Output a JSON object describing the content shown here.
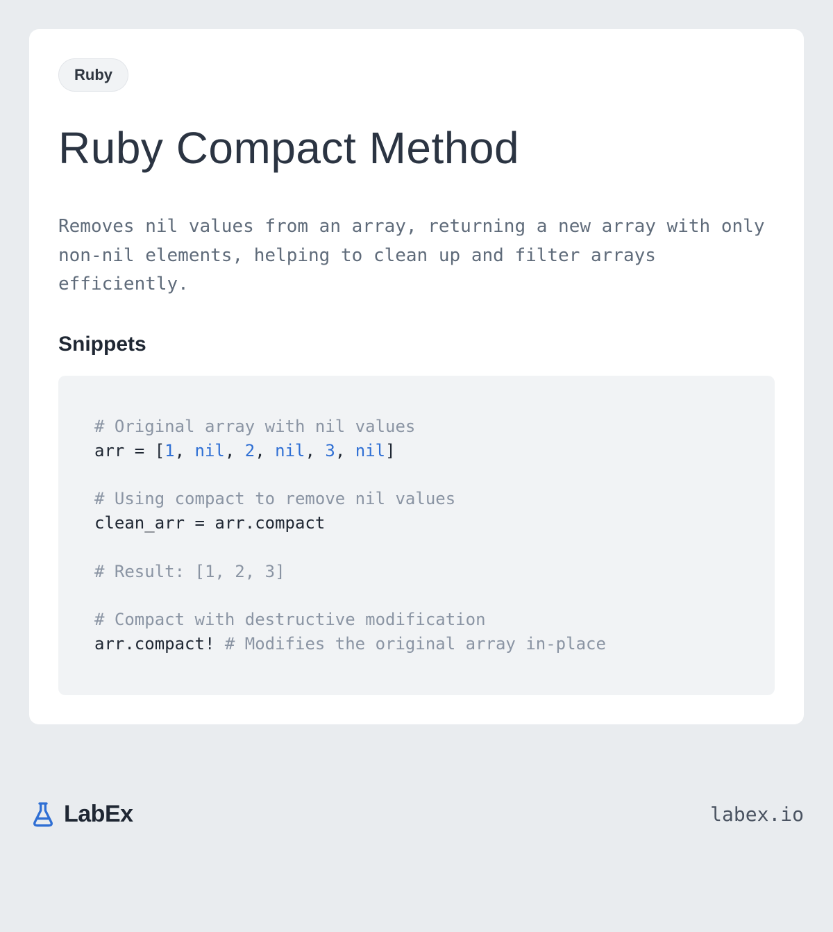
{
  "tag": "Ruby",
  "title": "Ruby Compact Method",
  "description": "Removes nil values from an array, returning a new array with only non-nil elements, helping to clean up and filter arrays efficiently.",
  "snippets_heading": "Snippets",
  "code": {
    "c1": "# Original array with nil values",
    "l1_a": "arr = [",
    "l1_n1": "1",
    "l1_s1": ", ",
    "l1_nil1": "nil",
    "l1_s2": ", ",
    "l1_n2": "2",
    "l1_s3": ", ",
    "l1_nil2": "nil",
    "l1_s4": ", ",
    "l1_n3": "3",
    "l1_s5": ", ",
    "l1_nil3": "nil",
    "l1_b": "]",
    "c2": "# Using compact to remove nil values",
    "l2": "clean_arr = arr.compact",
    "c3": "# Result: [1, 2, 3]",
    "c4": "# Compact with destructive modification",
    "l3a": "arr.compact! ",
    "c5": "# Modifies the original array in-place"
  },
  "brand": "LabEx",
  "domain": "labex.io"
}
